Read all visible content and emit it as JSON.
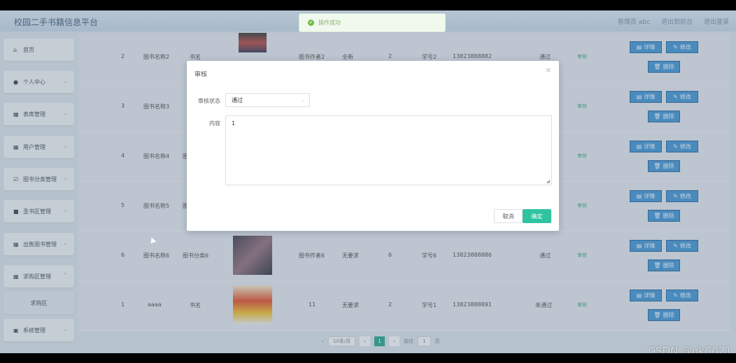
{
  "app": {
    "title": "校园二手书籍信息平台",
    "links": [
      "管理员 abc",
      "退出到前台",
      "退出登录"
    ]
  },
  "toast": {
    "message": "操作成功"
  },
  "sidebar": {
    "items": [
      {
        "label": "首页",
        "icon": "home-icon",
        "glyph": "⌂"
      },
      {
        "label": "个人中心",
        "icon": "user-icon",
        "glyph": "●"
      },
      {
        "label": "表库管理",
        "icon": "grid-icon",
        "glyph": "▦"
      },
      {
        "label": "用户管理",
        "icon": "grid-icon",
        "glyph": "▦"
      },
      {
        "label": "图书分类管理",
        "icon": "check-icon",
        "glyph": "☑"
      },
      {
        "label": "圣书区管理",
        "icon": "book-icon",
        "glyph": "■"
      },
      {
        "label": "出售图书管理",
        "icon": "grid-icon",
        "glyph": "▦"
      },
      {
        "label": "求购区管理",
        "icon": "grid-icon",
        "glyph": "▦"
      },
      {
        "label": "求购区",
        "icon": "",
        "glyph": ""
      },
      {
        "label": "系统管理",
        "icon": "settings-icon",
        "glyph": "▣"
      }
    ]
  },
  "table": {
    "rows": [
      {
        "index": "2",
        "name": "图书名称2",
        "category": "书名",
        "author": "图书作者2",
        "condition": "全新",
        "qty": "2",
        "account": "学号2",
        "phone": "13823888882",
        "status": "通过",
        "review_link": "审核"
      },
      {
        "index": "3",
        "name": "图书名称3",
        "category": "",
        "author": "",
        "condition": "",
        "qty": "",
        "account": "",
        "phone": "",
        "status": "",
        "review_link": "审核"
      },
      {
        "index": "4",
        "name": "图书名称4",
        "category": "图",
        "author": "",
        "condition": "",
        "qty": "",
        "account": "",
        "phone": "",
        "status": "",
        "review_link": "审核"
      },
      {
        "index": "5",
        "name": "图书名称5",
        "category": "图",
        "author": "",
        "condition": "",
        "qty": "",
        "account": "",
        "phone": "",
        "status": "",
        "review_link": "审核"
      },
      {
        "index": "6",
        "name": "图书名称6",
        "category": "图书分类6",
        "author": "图书作者6",
        "condition": "无要求",
        "qty": "6",
        "account": "学号6",
        "phone": "13823888886",
        "status": "通过",
        "review_link": "审核"
      },
      {
        "index": "1",
        "name": "aaaa",
        "category": "书名",
        "author": "11",
        "condition": "无要求",
        "qty": "2",
        "account": "学号1",
        "phone": "13823888891",
        "status": "未通过",
        "review_link": "审核"
      }
    ],
    "actions": {
      "detail": "详情",
      "edit": "修改",
      "delete": "删除"
    }
  },
  "pagination": {
    "page_size": "10条/页",
    "current_page": "1",
    "goto_label": "前往",
    "goto_value": "1",
    "page_suffix": "页"
  },
  "modal": {
    "title": "审核",
    "status_label": "审核状态",
    "status_value": "通过",
    "content_label": "内容",
    "content_value": "1",
    "cancel_label": "取消",
    "confirm_label": "确定"
  },
  "watermark": "CSDN @okC021"
}
